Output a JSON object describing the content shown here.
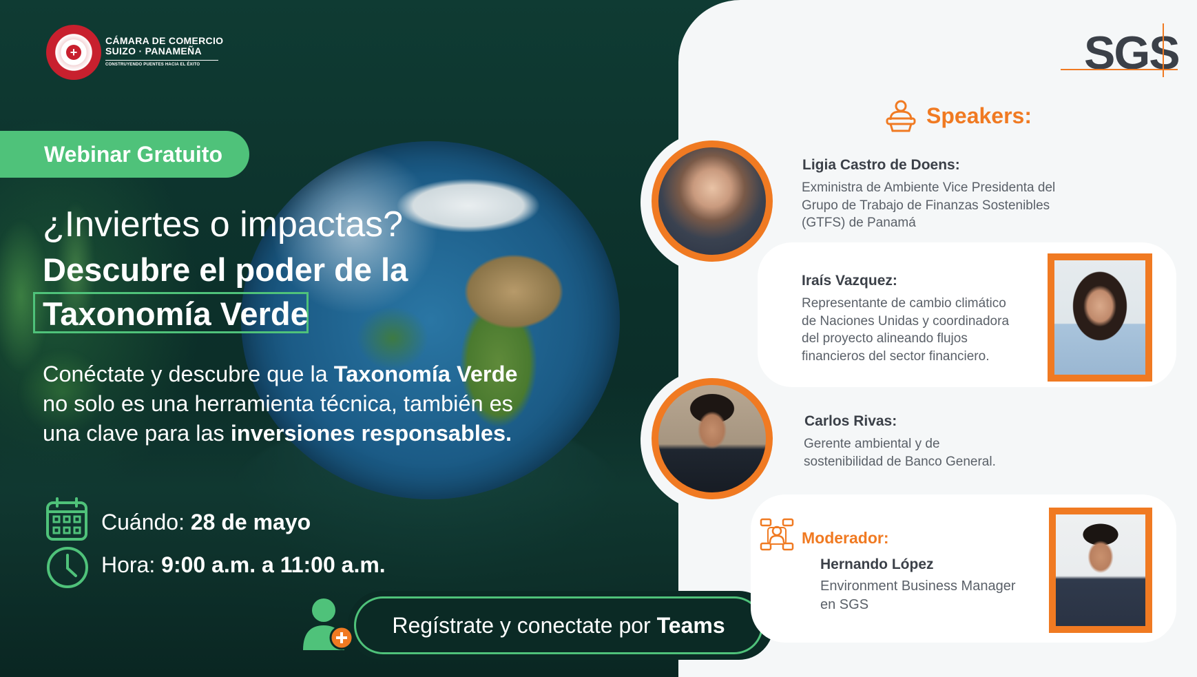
{
  "organizer": {
    "line1": "CÁMARA DE COMERCIO",
    "line2": "SUIZO · PANAMEÑA",
    "tagline": "CONSTRUYENDO PUENTES HACIA EL ÉXITO"
  },
  "badge": "Webinar Gratuito",
  "headline": {
    "question": "¿Inviertes o impactas?",
    "line1": "Descubre el poder de la",
    "line2": "Taxonomía Verde"
  },
  "body": {
    "p1": "Conéctate y descubre que la ",
    "b1": "Taxonomía Verde",
    "p2": " no solo es una herramienta técnica, también es una clave para las ",
    "b2": "inversiones responsables."
  },
  "when": {
    "label": "Cuándo: ",
    "value": "28 de mayo"
  },
  "time": {
    "label": "Hora: ",
    "value": "9:00 a.m. a 11:00 a.m."
  },
  "register": {
    "text": "Regístrate y conectate por ",
    "platform": "Teams"
  },
  "brand": "SGS",
  "speakers_title": "Speakers:",
  "speakers": [
    {
      "name": "Ligia Castro de Doens:",
      "desc": [
        "Exministra de Ambiente Vice Presidenta del",
        "Grupo de Trabajo de Finanzas Sostenibles",
        "(GTFS) de Panamá"
      ]
    },
    {
      "name": "Iraís Vazquez:",
      "desc": [
        "Representante de cambio climático",
        "de Naciones Unidas y  coordinadora",
        "del proyecto alineando flujos",
        "financieros del sector financiero."
      ]
    },
    {
      "name": "Carlos Rivas:",
      "desc": [
        "Gerente ambiental y de",
        "sostenibilidad de Banco General."
      ]
    }
  ],
  "moderator_title": "Moderador:",
  "moderator": {
    "name": "Hernando López",
    "desc": [
      "Environment Business Manager",
      "en SGS"
    ]
  },
  "colors": {
    "green": "#4fc27a",
    "orange": "#f07a22",
    "dark": "#0d2f29",
    "text": "#3b4048"
  },
  "icons": [
    "calendar-icon",
    "clock-icon",
    "add-user-icon",
    "speaker-podium-icon",
    "moderator-icon"
  ]
}
